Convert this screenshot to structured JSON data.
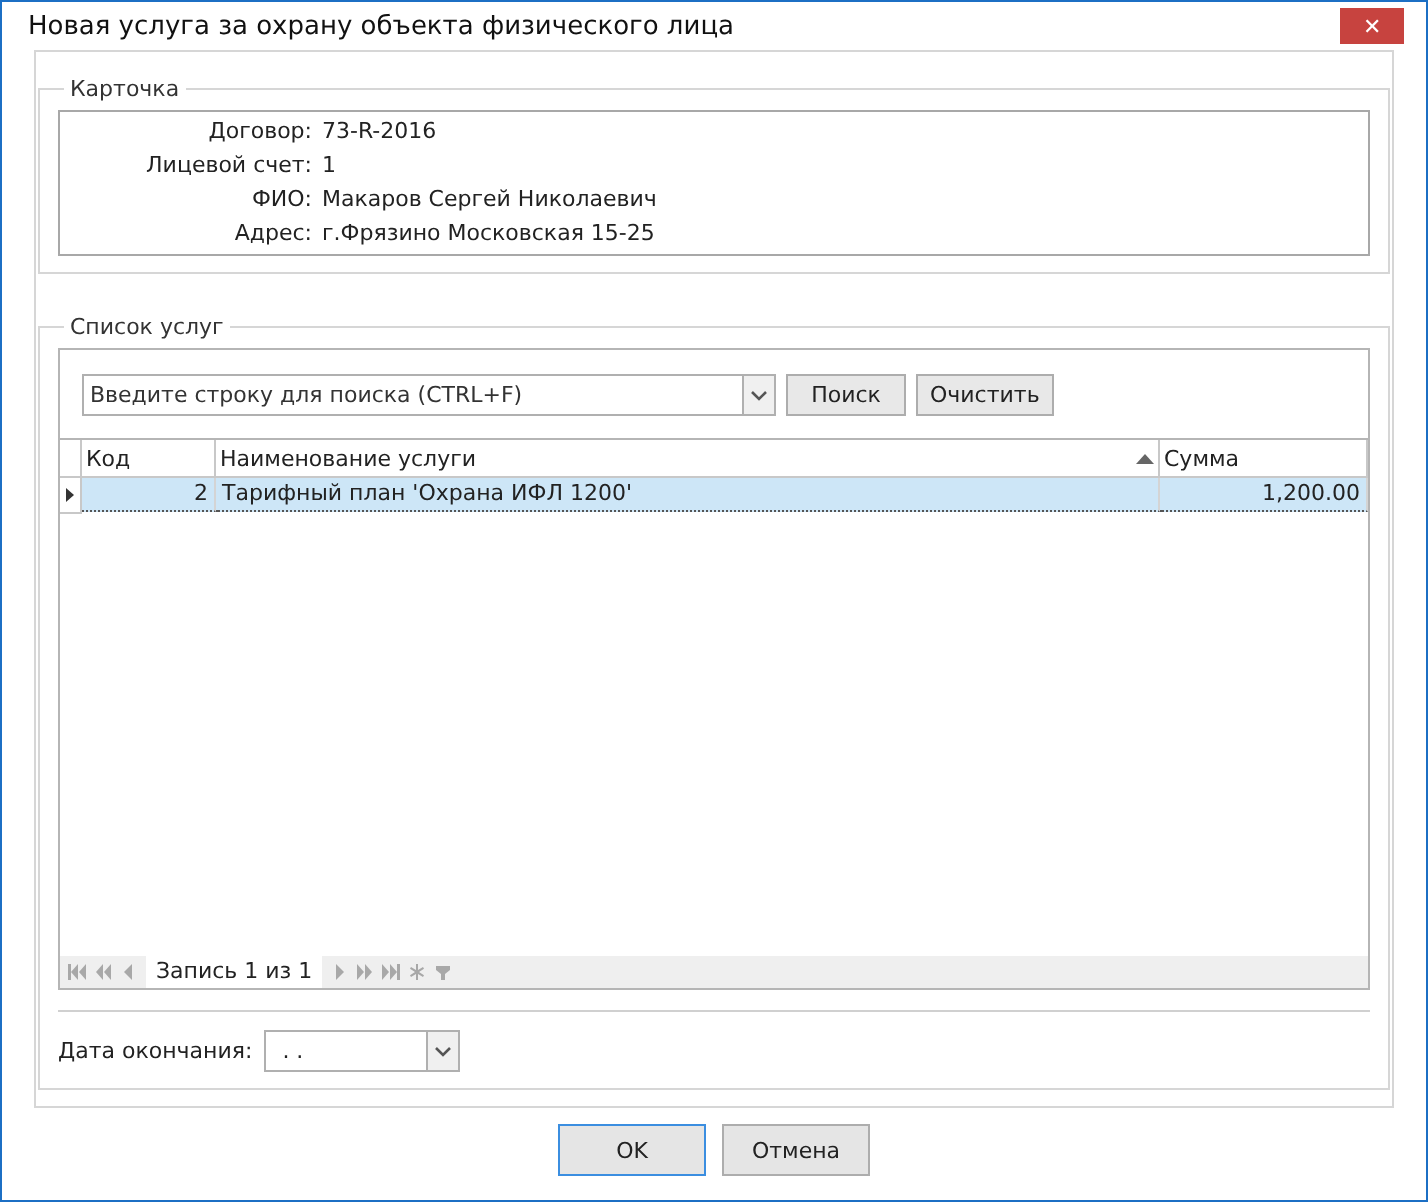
{
  "window": {
    "title": "Новая услуга за охрану объекта физического лица",
    "close": "✕"
  },
  "card": {
    "title": "Карточка",
    "fields": [
      {
        "label": "Договор:",
        "value": "73-R-2016"
      },
      {
        "label": "Лицевой счет:",
        "value": "1"
      },
      {
        "label": "ФИО:",
        "value": "Макаров Сергей Николаевич"
      },
      {
        "label": "Адрес:",
        "value": "г.Фрязино Московская 15-25"
      }
    ]
  },
  "services": {
    "title": "Список услуг",
    "search": {
      "placeholder": "Введите строку для поиска (CTRL+F)"
    },
    "buttons": [
      "Поиск",
      "Очистить"
    ],
    "table": {
      "columns": [
        {
          "label": "Код",
          "sorted": false
        },
        {
          "label": "Наименование услуги",
          "sorted": true
        },
        {
          "label": "Сумма",
          "sorted": false
        }
      ],
      "rows": [
        {
          "selected": true,
          "cells": [
            "2",
            "Тарифный план 'Охрана ИФЛ 1200'",
            "1,200.00"
          ]
        }
      ]
    },
    "navigator": {
      "record": "Запись 1 из 1"
    }
  },
  "end_date": {
    "label": "Дата окончания:",
    "value": ". ."
  },
  "buttons": [
    {
      "label": "OK",
      "default": true
    },
    {
      "label": "Отмена",
      "default": false
    }
  ]
}
